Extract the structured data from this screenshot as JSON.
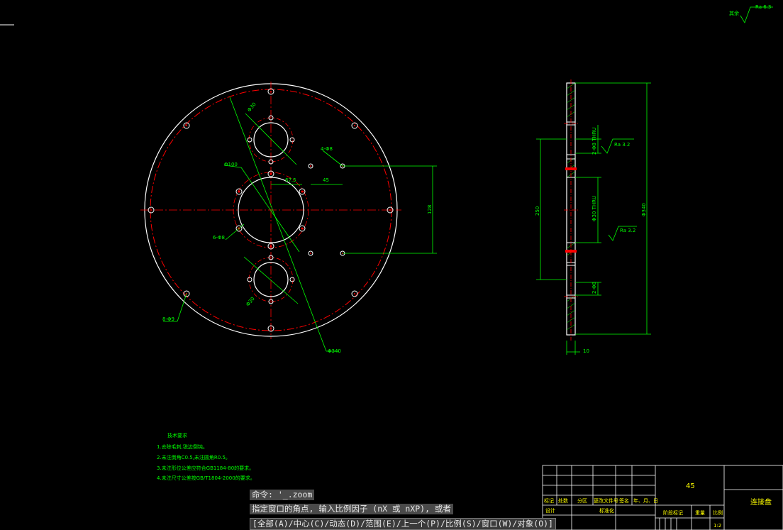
{
  "command_line": {
    "line1": "命令: '_.zoom",
    "line2": "指定窗口的角点, 输入比例因子 (nX 或 nXP), 或者",
    "line3": "[全部(A)/中心(C)/动态(D)/范围(E)/上一个(P)/比例(S)/窗口(W)/对象(O)]"
  },
  "roughness": {
    "other_label": "其余",
    "other_value": "Ra 6.3",
    "side_top": "Ra 3.2",
    "side_mid": "Ra 3.2"
  },
  "dimensions": {
    "phi30": "Φ30",
    "phi100": "Φ100",
    "phi67_5": "67.5",
    "d45": "45",
    "n4_phi8": "4-Φ8",
    "n6_phi8": "6-Φ8",
    "n8_phi9": "8-Φ9",
    "d128": "128",
    "phi340": "Φ340",
    "phi340b": "Φ340",
    "phi30b": "Φ30",
    "d250": "250",
    "side_top": "2-Φ8 THRU",
    "side_mid": "Φ30 THRU",
    "side_bot": "2-Φ8",
    "d10": "10"
  },
  "notes": {
    "title": "技术要求",
    "items": [
      "1.去除毛刺,锐边倒钝。",
      "2.未注倒角C0.5,未注圆角R0.5。",
      "3.未注形位公差应符合GB1184-80的要求。",
      "4.未注尺寸公差按GB/T1804-2000的要求。"
    ]
  },
  "title_block": {
    "material": "45",
    "part_name": "连接盘",
    "labels": [
      "标记",
      "处数",
      "分区",
      "更改文件号",
      "签名",
      "年、月、日"
    ],
    "designer": "设计",
    "standardized": "标准化",
    "stage_mark": "阶段标记",
    "weight": "重量",
    "scale_label": "比例",
    "scale_value": "1:2"
  }
}
